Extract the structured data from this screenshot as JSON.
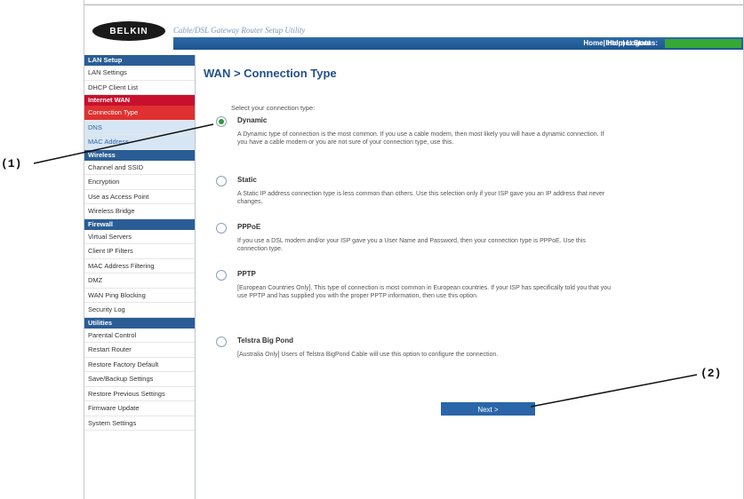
{
  "header": {
    "logo": "BELKIN",
    "app_title": "Cable/DSL Gateway Router Setup Utility",
    "links": "Home| Help| Logout",
    "status_label": "Internet Status:"
  },
  "sidebar": {
    "sections": [
      {
        "title": "LAN Setup",
        "items": [
          "LAN Settings",
          "DHCP Client List"
        ]
      },
      {
        "title": "Internet WAN",
        "items": [
          "Connection Type",
          "DNS",
          "MAC Address"
        ]
      },
      {
        "title": "Wireless",
        "items": [
          "Channel and SSID",
          "Encryption",
          "Use as Access Point",
          "Wireless Bridge"
        ]
      },
      {
        "title": "Firewall",
        "items": [
          "Virtual Servers",
          "Client IP Filters",
          "MAC Address Filtering",
          "DMZ",
          "WAN Ping Blocking",
          "Security Log"
        ]
      },
      {
        "title": "Utilities",
        "items": [
          "Parental Control",
          "Restart Router",
          "Restore Factory Default",
          "Save/Backup Settings",
          "Restore Previous Settings",
          "Firmware Update",
          "System Settings"
        ]
      }
    ]
  },
  "main": {
    "title": "WAN > Connection Type",
    "prompt": "Select your connection type:",
    "options": [
      {
        "title": "Dynamic",
        "desc": "A Dynamic type of connection is the most common. If you use a cable modem, then most likely you will have a dynamic connection. If you have a cable modem or you are not sure of your connection type, use this.",
        "selected": true
      },
      {
        "title": "Static",
        "desc": "A Static IP address connection type is less common than others. Use this selection only if your ISP gave you an IP address that never changes.",
        "selected": false
      },
      {
        "title": "PPPoE",
        "desc": "If you use a DSL modem and/or your ISP gave you a User Name and Password, then your connection type is PPPoE. Use this connection type.",
        "selected": false
      },
      {
        "title": "PPTP",
        "desc": "[European Countries Only]. This type of connection is most common in European countries. If your ISP has specifically told you that you use PPTP and has supplied you with the proper PPTP information, then use this option.",
        "selected": false
      },
      {
        "title": "Telstra Big Pond",
        "desc": "[Australia Only] Users of Telstra BigPond Cable will use this option to configure the connection.",
        "selected": false
      }
    ],
    "next_label": "Next >"
  },
  "callouts": {
    "c1": "(1)",
    "c2": "(2)"
  }
}
